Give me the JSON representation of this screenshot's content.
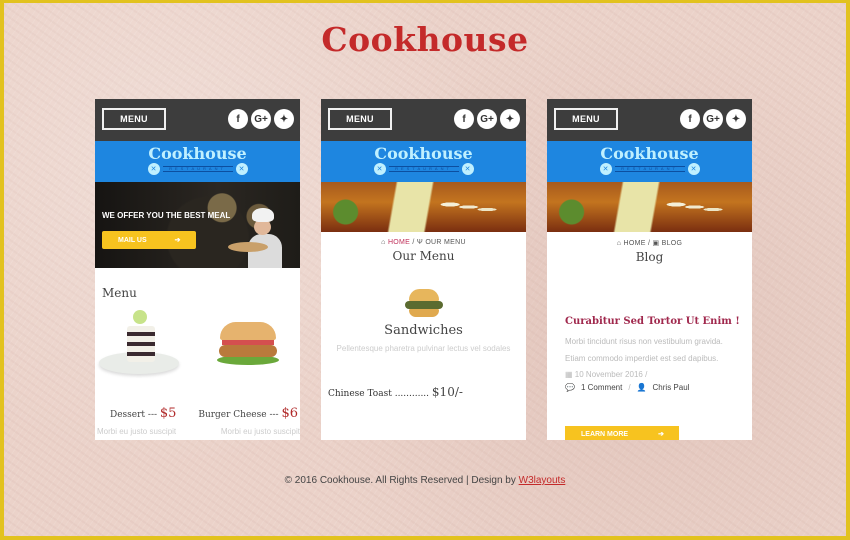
{
  "site": {
    "title": "Cookhouse"
  },
  "common": {
    "menu_label": "MENU",
    "socials": [
      {
        "name": "facebook",
        "glyph": "f"
      },
      {
        "name": "google-plus",
        "glyph": "G+"
      },
      {
        "name": "twitter",
        "glyph": "🐦"
      }
    ],
    "brand": {
      "name": "Cookhouse",
      "subtitle": "RESTAURANT"
    }
  },
  "screen1": {
    "hero_tagline": "WE OFFER YOU THE BEST MEAL",
    "hero_button": "MAIL US",
    "section_title": "Menu",
    "dishes": [
      {
        "name": "Dessert",
        "sep": "---",
        "price": "$5",
        "desc": "Morbi eu justo suscipit"
      },
      {
        "name": "Burger Cheese",
        "sep": "---",
        "price": "$6",
        "desc": "Morbi eu justo suscipit"
      }
    ]
  },
  "screen2": {
    "breadcrumb": {
      "home": "HOME",
      "sep": "/",
      "current": "OUR MENU"
    },
    "page_title": "Our Menu",
    "category": "Sandwiches",
    "category_desc": "Pellentesque pharetra pulvinar lectus vel sodales",
    "item": {
      "name": "Chinese Toast",
      "dots": "............",
      "price": "$10/-"
    }
  },
  "screen3": {
    "breadcrumb": {
      "home": "HOME",
      "sep": "/",
      "current": "BLOG"
    },
    "page_title": "Blog",
    "post_title": "Curabitur Sed Tortor Ut Enim !",
    "post_excerpt": "Morbi tincidunt risus non vestibulum gravida. Etiam commodo imperdiet est sed dapibus.",
    "date": "10 November 2016",
    "comments": "1 Comment",
    "author": "Chris Paul",
    "button": "LEARN MORE"
  },
  "footer": {
    "text": "© 2016 Cookhouse. All Rights Reserved | Design by ",
    "link": "W3layouts"
  }
}
